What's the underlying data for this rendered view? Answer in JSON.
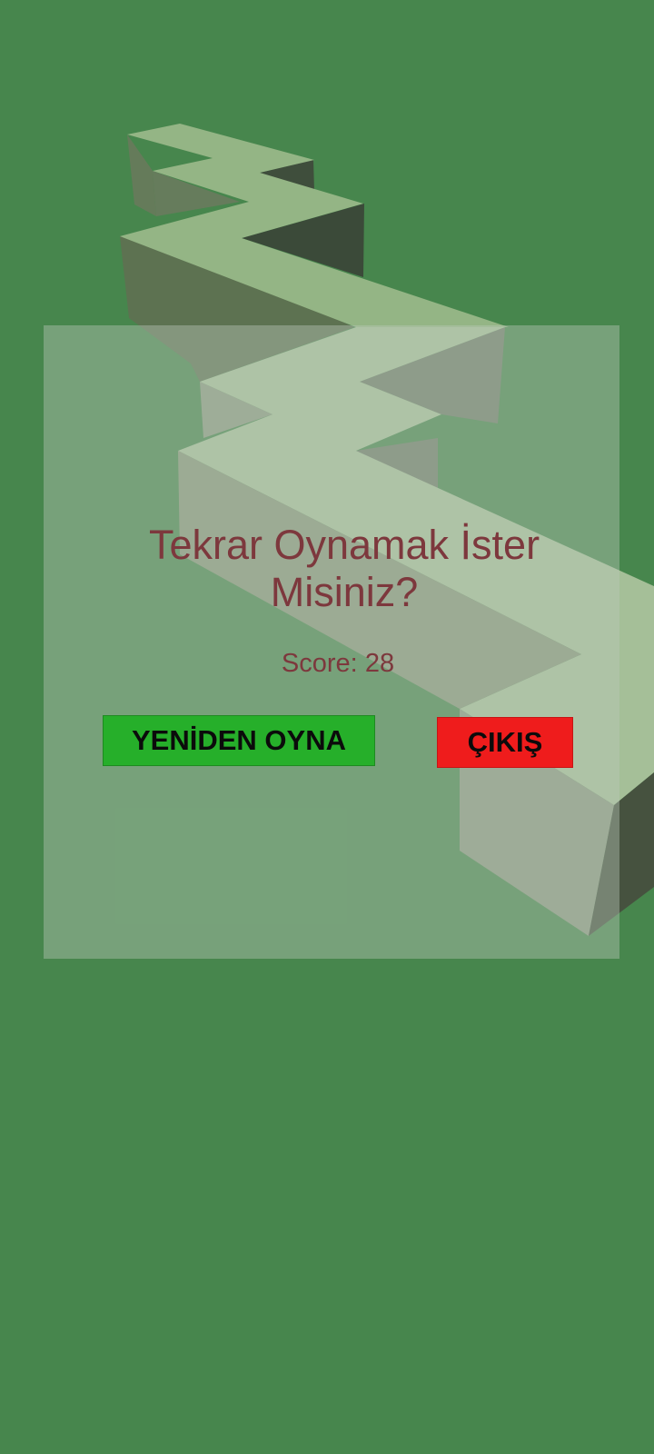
{
  "dialog": {
    "title_line1": "Tekrar Oynamak İster",
    "title_line2": "Misiniz?",
    "score_label": "Score:",
    "score_value": 28,
    "replay_label": "YENİDEN OYNA",
    "exit_label": "ÇIKIŞ"
  },
  "colors": {
    "background": "#47864d",
    "text": "#7d383d",
    "replay_button": "#26af2a",
    "exit_button": "#ef1c1c",
    "path_top": "#92b283",
    "path_side_left": "#5f7353",
    "path_side_right": "#3d4c3b"
  }
}
